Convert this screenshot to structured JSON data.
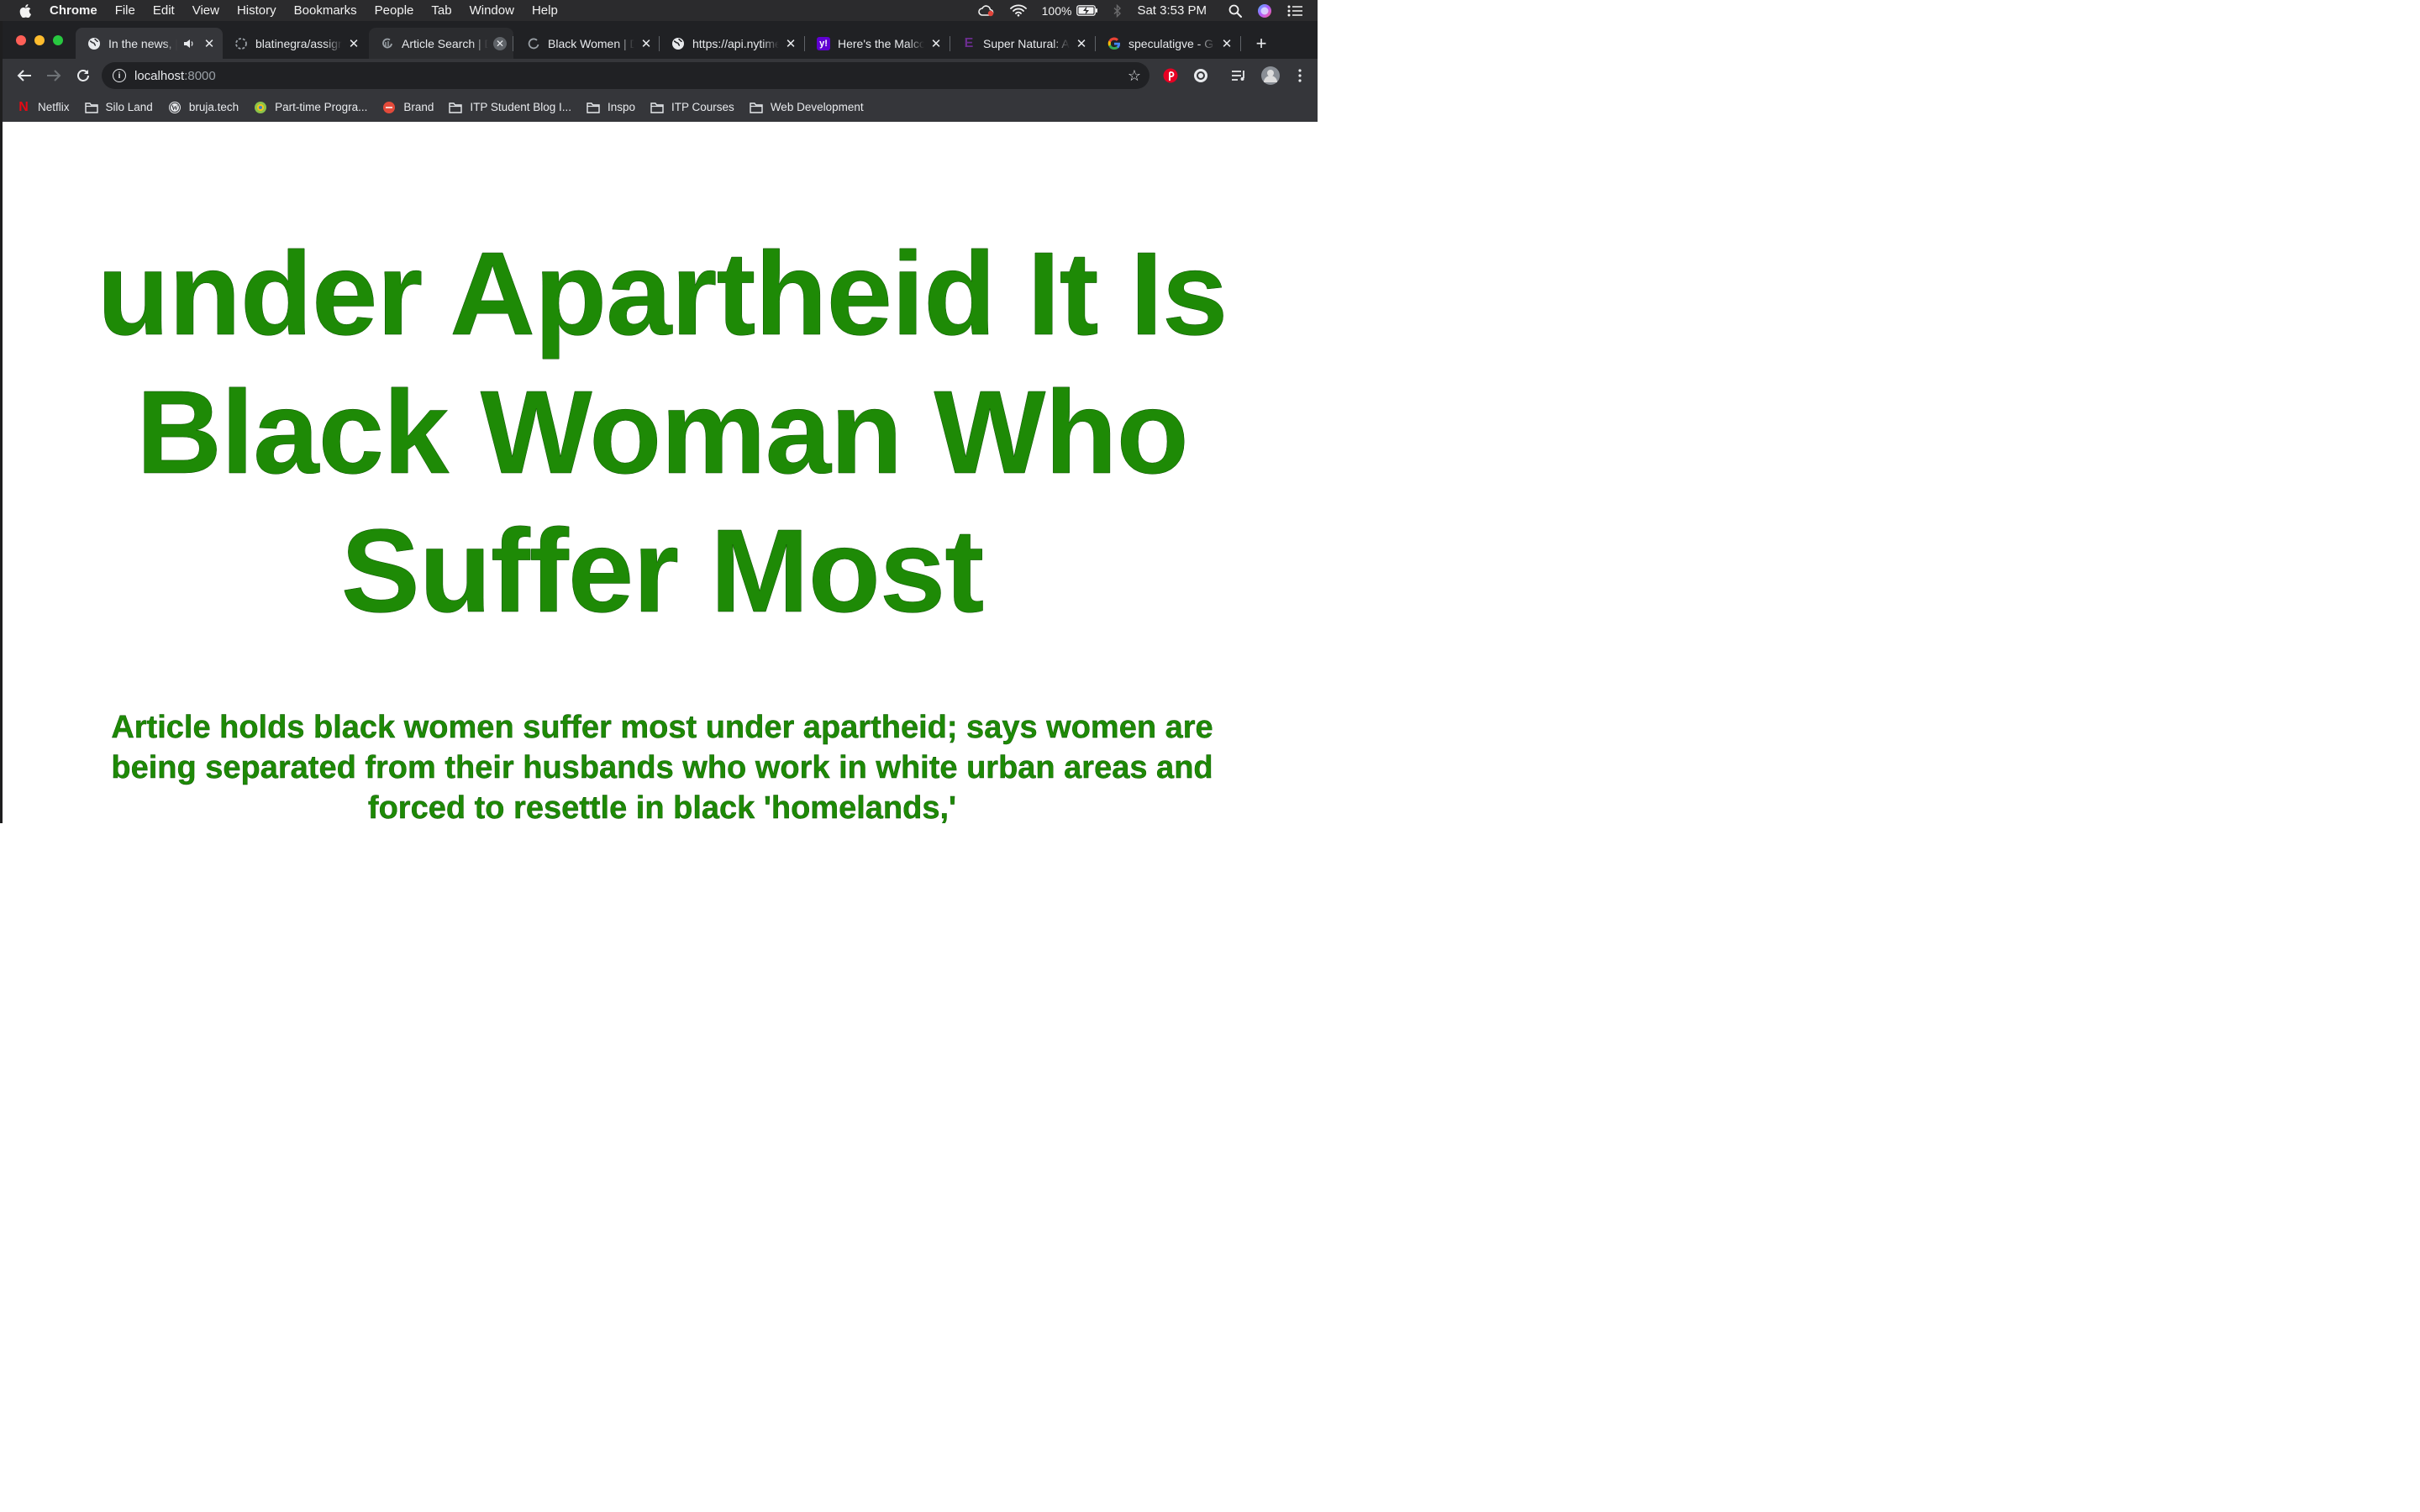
{
  "menubar": {
    "app_name": "Chrome",
    "items": [
      "File",
      "Edit",
      "View",
      "History",
      "Bookmarks",
      "People",
      "Tab",
      "Window",
      "Help"
    ],
    "battery": "100%",
    "clock": "Sat 3:53 PM"
  },
  "tabs": [
    {
      "title": "In the news, |",
      "icon": "globe-icon"
    },
    {
      "title": "blatinegra/assign",
      "icon": "loading-spinner-icon"
    },
    {
      "title": "Article Search | D",
      "icon": "nyt-icon"
    },
    {
      "title": "Black Women | D",
      "icon": "loading-spinner-icon"
    },
    {
      "title": "https://api.nytime",
      "icon": "globe-icon"
    },
    {
      "title": "Here's the Malco",
      "icon": "yahoo-icon"
    },
    {
      "title": "Super Natural: A",
      "icon": "e-logo-icon"
    },
    {
      "title": "speculatigve - G",
      "icon": "google-icon"
    }
  ],
  "address_bar": {
    "host": "localhost",
    "port": ":8000"
  },
  "bookmarks": [
    {
      "label": "Netflix",
      "icon": "netflix-icon"
    },
    {
      "label": "Silo Land",
      "icon": "folder-icon"
    },
    {
      "label": "bruja.tech",
      "icon": "wordpress-icon"
    },
    {
      "label": "Part-time Progra...",
      "icon": "site-icon"
    },
    {
      "label": "Brand",
      "icon": "site-icon"
    },
    {
      "label": "ITP Student Blog I...",
      "icon": "folder-icon"
    },
    {
      "label": "Inspo",
      "icon": "folder-icon"
    },
    {
      "label": "ITP Courses",
      "icon": "folder-icon"
    },
    {
      "label": "Web Development",
      "icon": "folder-icon"
    }
  ],
  "article": {
    "headline": "under Apartheid It Is Black Woman Who Suffer Most",
    "abstract": "Article holds black women suffer most under apartheid; says women are being separated from their husbands who work in white urban areas and forced to resettle in black 'homelands,'",
    "text_color": "#1e8a06"
  },
  "colors": {
    "tabstrip": "#202124",
    "toolbar": "#35363a"
  }
}
